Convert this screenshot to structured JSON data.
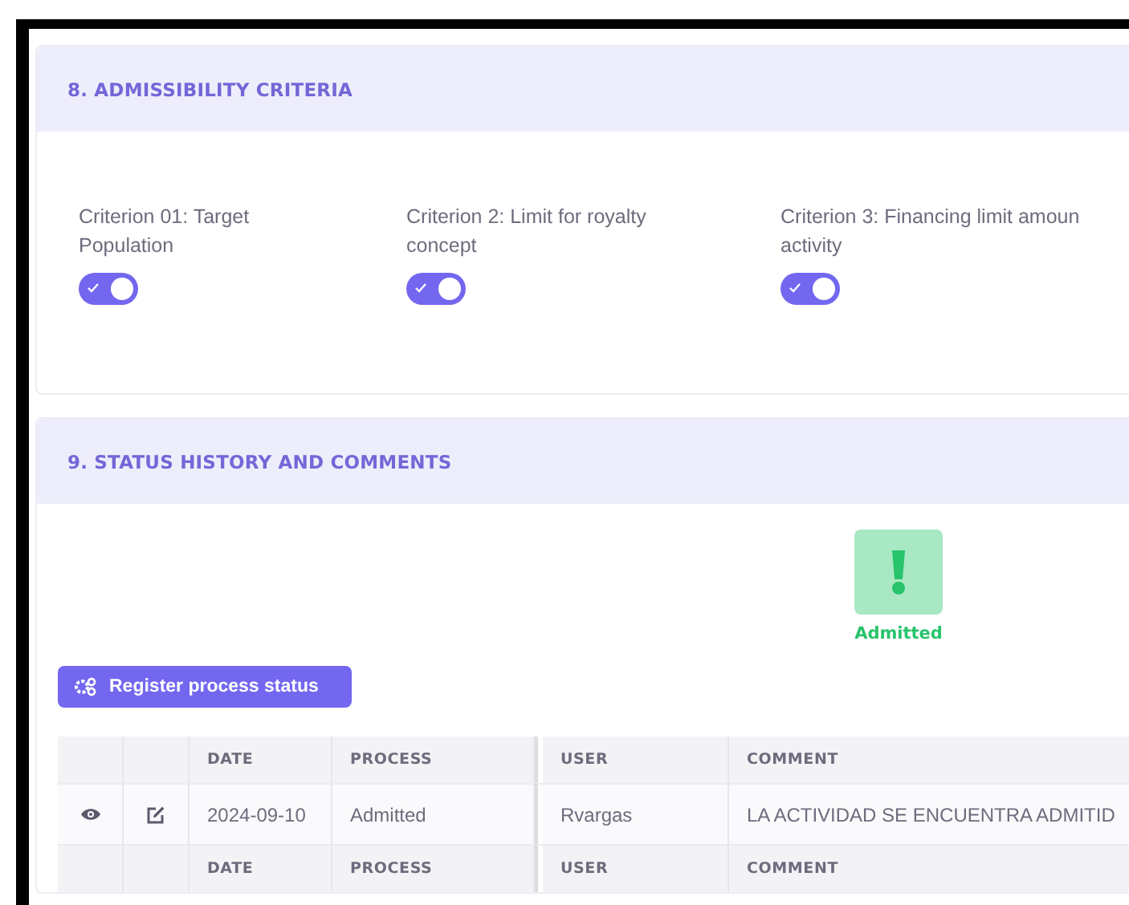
{
  "sections": [
    {
      "title": "8. ADMISSIBILITY CRITERIA",
      "kind": "criteria"
    },
    {
      "title": "9. STATUS HISTORY AND COMMENTS",
      "kind": "history"
    }
  ],
  "criteria": [
    {
      "label": "Criterion 01: Target\nPopulation",
      "on": true
    },
    {
      "label": "Criterion 2: Limit for royalty\nconcept",
      "on": true
    },
    {
      "label": "Criterion 3: Financing limit amoun\nactivity",
      "on": true
    }
  ],
  "status": {
    "label": "Admitted",
    "color": "#27c46b"
  },
  "register_button": "Register process status",
  "table": {
    "columns": [
      "",
      "",
      "DATE",
      "PROCESS",
      "USER",
      "COMMENT"
    ],
    "rows": [
      {
        "date": "2024-09-10",
        "process": "Admitted",
        "user": "Rvargas",
        "comment": "LA ACTIVIDAD SE ENCUENTRA ADMITID"
      }
    ],
    "footer_columns": [
      "",
      "",
      "DATE",
      "PROCESS",
      "USER",
      "COMMENT"
    ]
  }
}
